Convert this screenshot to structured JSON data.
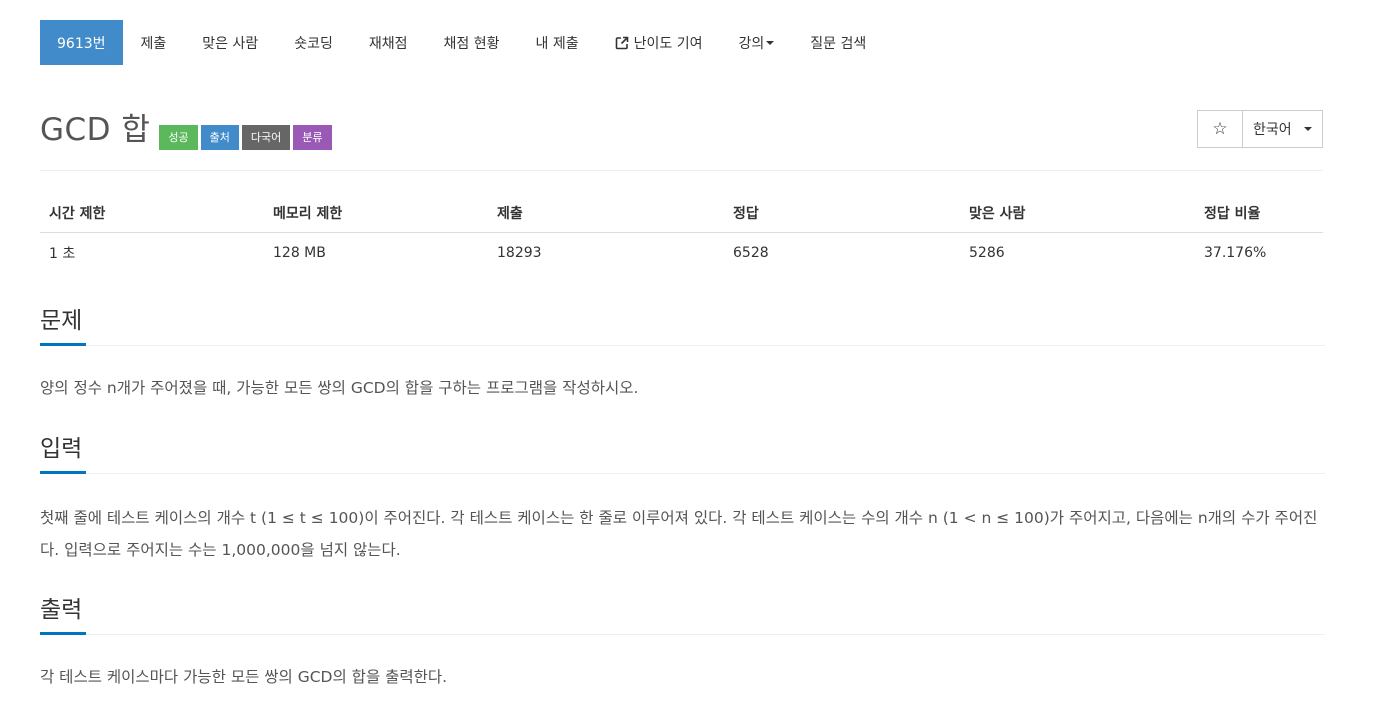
{
  "nav": {
    "tabs": [
      {
        "label": "9613번",
        "active": true
      },
      {
        "label": "제출"
      },
      {
        "label": "맞은 사람"
      },
      {
        "label": "숏코딩"
      },
      {
        "label": "재채점"
      },
      {
        "label": "채점 현황"
      },
      {
        "label": "내 제출"
      },
      {
        "label": "난이도 기여",
        "icon": "external-link-icon"
      },
      {
        "label": "강의",
        "icon": "caret-down-icon"
      },
      {
        "label": "질문 검색"
      }
    ]
  },
  "problem": {
    "title": "GCD 합",
    "labels": [
      {
        "text": "성공",
        "color": "#5cb85c"
      },
      {
        "text": "출처",
        "color": "#428bca"
      },
      {
        "text": "다국어",
        "color": "#666666"
      },
      {
        "text": "분류",
        "color": "#9b59b6"
      }
    ],
    "star_symbol": "☆",
    "language": "한국어"
  },
  "stats": {
    "headers": [
      "시간 제한",
      "메모리 제한",
      "제출",
      "정답",
      "맞은 사람",
      "정답 비율"
    ],
    "values": [
      "1 초",
      "128 MB",
      "18293",
      "6528",
      "5286",
      "37.176%"
    ]
  },
  "sections": {
    "problem": {
      "title": "문제",
      "body": "양의 정수 n개가 주어졌을 때, 가능한 모든 쌍의 GCD의 합을 구하는 프로그램을 작성하시오."
    },
    "input": {
      "title": "입력",
      "body": "첫째 줄에 테스트 케이스의 개수 t (1 ≤ t ≤ 100)이 주어진다. 각 테스트 케이스는 한 줄로 이루어져 있다. 각 테스트 케이스는 수의 개수 n (1 < n ≤ 100)가 주어지고, 다음에는 n개의 수가 주어진다. 입력으로 주어지는 수는 1,000,000을 넘지 않는다."
    },
    "output": {
      "title": "출력",
      "body": "각 테스트 케이스마다 가능한 모든 쌍의 GCD의 합을 출력한다."
    }
  },
  "colors": {
    "primary": "#428bca",
    "section_accent": "#0076c0"
  }
}
